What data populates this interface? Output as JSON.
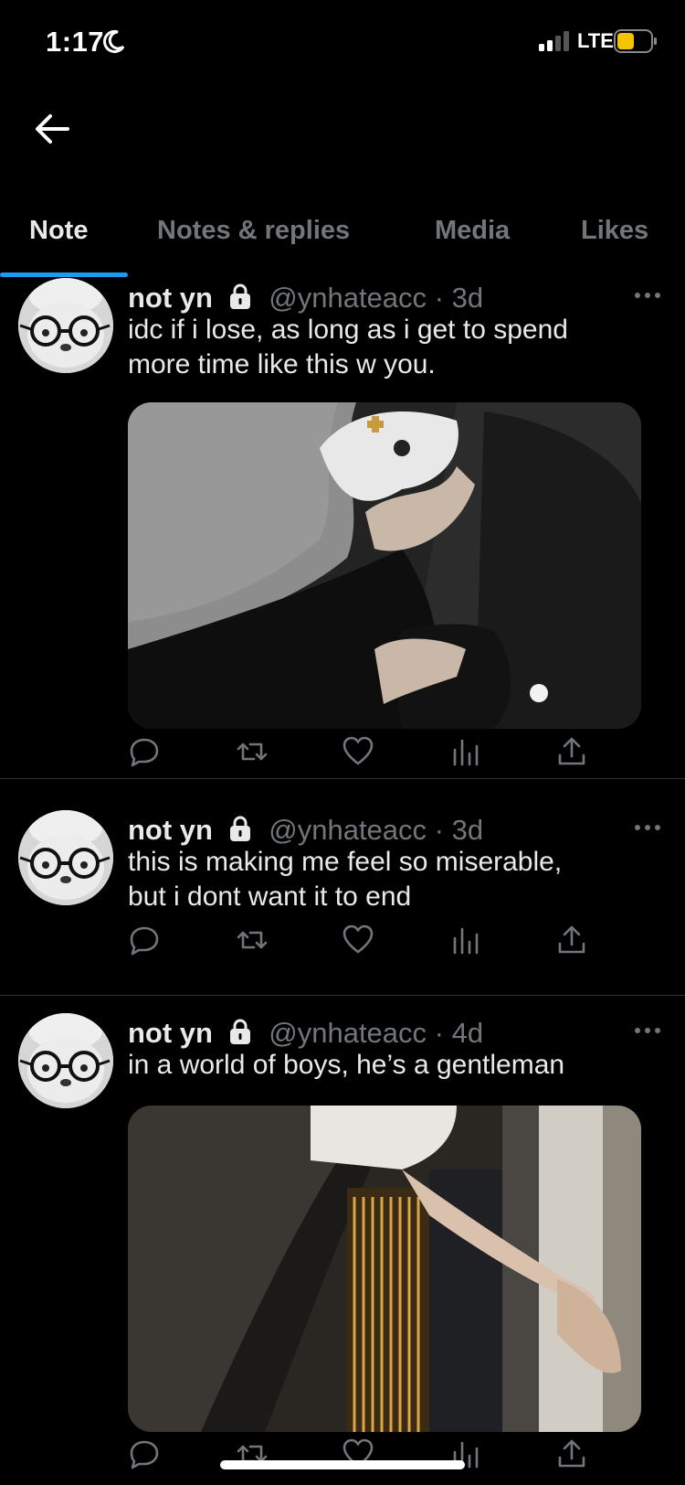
{
  "status_bar": {
    "time": "1:17",
    "network": "LTE",
    "icons": [
      "moon-icon",
      "signal-icon",
      "battery-icon"
    ],
    "battery_color": "#f5c400"
  },
  "nav": {
    "back_icon": "arrow-left-icon"
  },
  "tabs": [
    {
      "label": "Note",
      "active": true
    },
    {
      "label": "Notes & replies",
      "active": false
    },
    {
      "label": "Media",
      "active": false
    },
    {
      "label": "Likes",
      "active": false
    }
  ],
  "accent_color": "#1d9bf0",
  "tweets": [
    {
      "display_name": "not yn",
      "handle": "@ynhateacc · 3d",
      "text_lines": [
        "idc if i lose, as long as i get to spend",
        "more time like this w you."
      ],
      "has_media": true,
      "media_description_icon": "photo-game-controller"
    },
    {
      "display_name": "not yn",
      "handle": "@ynhateacc · 3d",
      "text_lines": [
        "this is making me feel so miserable,",
        "but i dont want it to end"
      ],
      "has_media": false
    },
    {
      "display_name": "not yn",
      "handle": "@ynhateacc · 4d",
      "text_lines": [
        "in a world of boys, he’s a gentleman"
      ],
      "has_media": true,
      "media_description_icon": "photo-open-door"
    }
  ],
  "action_icons": [
    "reply-icon",
    "retweet-icon",
    "like-icon",
    "views-icon",
    "share-icon"
  ]
}
